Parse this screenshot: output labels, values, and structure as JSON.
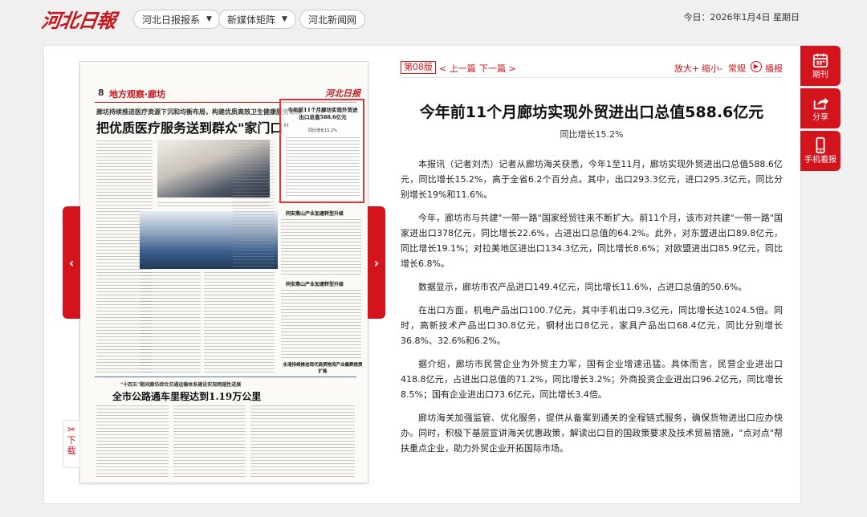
{
  "header": {
    "logo": "河北日報",
    "nav": [
      {
        "label": "河北日报报系",
        "has_dropdown": true
      },
      {
        "label": "新媒体矩阵",
        "has_dropdown": true
      },
      {
        "label": "河北新闻网",
        "has_dropdown": false
      }
    ],
    "date": "今日：2026年1月4日 星期日"
  },
  "newspaper": {
    "page_number": "8",
    "section": "地方观察·廊坊",
    "masthead": "河北日报",
    "subhead": "廊坊持续推进医疗资源下沉和均衡布局，构建优质高效卫生健康服务体系",
    "headline": "把优质医疗服务送到群众\"家门口\"",
    "highlight_title": "今年前11个月廊坊实现外贸进出口总值588.6亿元",
    "highlight_sub": "同比增长15.2%",
    "story2_title": "同安燕山产业加速转型升级",
    "story3_title": "永清持续推进现代商贸物流产业集群提质扩能",
    "bottom_subhead": "\"十四五\"期间廊坊综合交通运输体系建设实现跨越性进展",
    "bottom_headline": "全市公路通车里程达到1.19万公里",
    "left_arrow": "‹",
    "right_arrow": "›",
    "download_label": "下载"
  },
  "article": {
    "edition": "第08版",
    "prev": "< 上一篇",
    "next": "下一篇 >",
    "zoom_in": "放大+",
    "zoom_out": "缩小-",
    "normal": "常规",
    "play": "播报",
    "title": "今年前11个月廊坊实现外贸进出口总值588.6亿元",
    "subtitle": "同比增长15.2%",
    "paragraphs": [
      "本报讯（记者刘杰）记者从廊坊海关获悉，今年1至11月，廊坊实现外贸进出口总值588.6亿元，同比增长15.2%，高于全省6.2个百分点。其中，出口293.3亿元，进口295.3亿元，同比分别增长19%和11.6%。",
      "今年，廊坊市与共建\"一带一路\"国家经贸往来不断扩大。前11个月，该市对共建\"一带一路\"国家进出口378亿元，同比增长22.6%，占进出口总值的64.2%。此外，对东盟进出口89.8亿元，同比增长19.1%；对拉美地区进出口134.3亿元，同比增长8.6%；对欧盟进出口85.9亿元，同比增长6.8%。",
      "数据显示，廊坊市农产品进口149.4亿元，同比增长11.6%，占进口总值的50.6%。",
      "在出口方面，机电产品出口100.7亿元，其中手机出口9.3亿元，同比增长达1024.5倍。同时，高新技术产品出口30.8亿元，钢材出口8亿元，家具产品出口68.4亿元，同比分别增长36.8%、32.6%和6.2%。",
      "据介绍，廊坊市民营企业为外贸主力军，国有企业增速迅猛。具体而言，民营企业进出口418.8亿元，占进出口总值的71.2%，同比增长3.2%；外商投资企业进出口96.2亿元，同比增长8.5%；国有企业进出口73.6亿元，同比增长3.4倍。",
      "廊坊海关加强监管、优化服务，提供从备案到通关的全程链式服务，确保货物进出口应办快办。同时，积极下基层宣讲海关优惠政策，解读出口目的国政策要求及技术贸易措施，\"点对点\"帮扶重点企业，助力外贸企业开拓国际市场。"
    ]
  },
  "tools": [
    {
      "label": "期刊",
      "icon": "calendar-icon"
    },
    {
      "label": "分享",
      "icon": "share-icon"
    },
    {
      "label": "手机看报",
      "icon": "mobile-icon"
    }
  ],
  "colors": {
    "brand_red": "#d4141d",
    "highlight_red": "#e8323a"
  }
}
